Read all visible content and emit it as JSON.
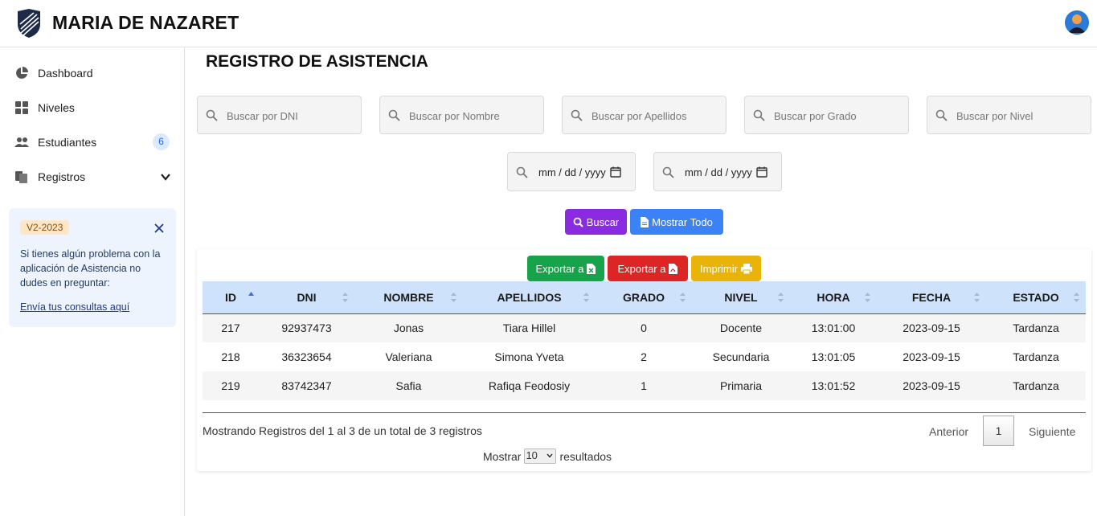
{
  "brand": {
    "name": "MARIA DE NAZARET"
  },
  "sidebar": {
    "items": [
      {
        "label": "Dashboard",
        "icon": "pie-chart-icon"
      },
      {
        "label": "Niveles",
        "icon": "grid-icon"
      },
      {
        "label": "Estudiantes",
        "icon": "users-icon",
        "badge": "6"
      },
      {
        "label": "Registros",
        "icon": "copy-icon",
        "expand": "chevron-down-icon"
      }
    ],
    "info": {
      "version": "V2-2023",
      "text": "Si tienes algún problema con la aplicación de Asistencia no dudes en preguntar:",
      "link": "Envía tus consultas aquí"
    }
  },
  "page": {
    "title": "REGISTRO DE ASISTENCIA"
  },
  "filters": {
    "dni": "Buscar por DNI",
    "nombre": "Buscar por Nombre",
    "apellidos": "Buscar por Apellidos",
    "grado": "Buscar por Grado",
    "nivel": "Buscar por Nivel",
    "date_from": "mm / dd / yyyy",
    "date_to": "mm / dd / yyyy"
  },
  "actions": {
    "buscar": "Buscar",
    "mostrar_todo": "Mostrar Todo",
    "export_excel": "Exportar a",
    "export_pdf": "Exportar a",
    "print": "Imprimir"
  },
  "colors": {
    "buscar": "#8a2be2",
    "mostrar_todo": "#3b82f6",
    "excel": "#16a34a",
    "pdf": "#dc2626",
    "print": "#eab308"
  },
  "table": {
    "headers": [
      "ID",
      "DNI",
      "NOMBRE",
      "APELLIDOS",
      "GRADO",
      "NIVEL",
      "HORA",
      "FECHA",
      "ESTADO"
    ],
    "rows": [
      [
        "217",
        "92937473",
        "Jonas",
        "Tiara Hillel",
        "0",
        "Docente",
        "13:01:00",
        "2023-09-15",
        "Tardanza"
      ],
      [
        "218",
        "36323654",
        "Valeriana",
        "Simona Yveta",
        "2",
        "Secundaria",
        "13:01:05",
        "2023-09-15",
        "Tardanza"
      ],
      [
        "219",
        "83742347",
        "Safia",
        "Rafiqa Feodosiy",
        "1",
        "Primaria",
        "13:01:52",
        "2023-09-15",
        "Tardanza"
      ]
    ],
    "sorted_by": "ID"
  },
  "footer": {
    "info": "Mostrando Registros del 1 al 3 de un total de 3 registros",
    "prev": "Anterior",
    "page": "1",
    "next": "Siguiente",
    "show_label": "Mostrar",
    "show_value": "10",
    "results_label": "resultados"
  }
}
